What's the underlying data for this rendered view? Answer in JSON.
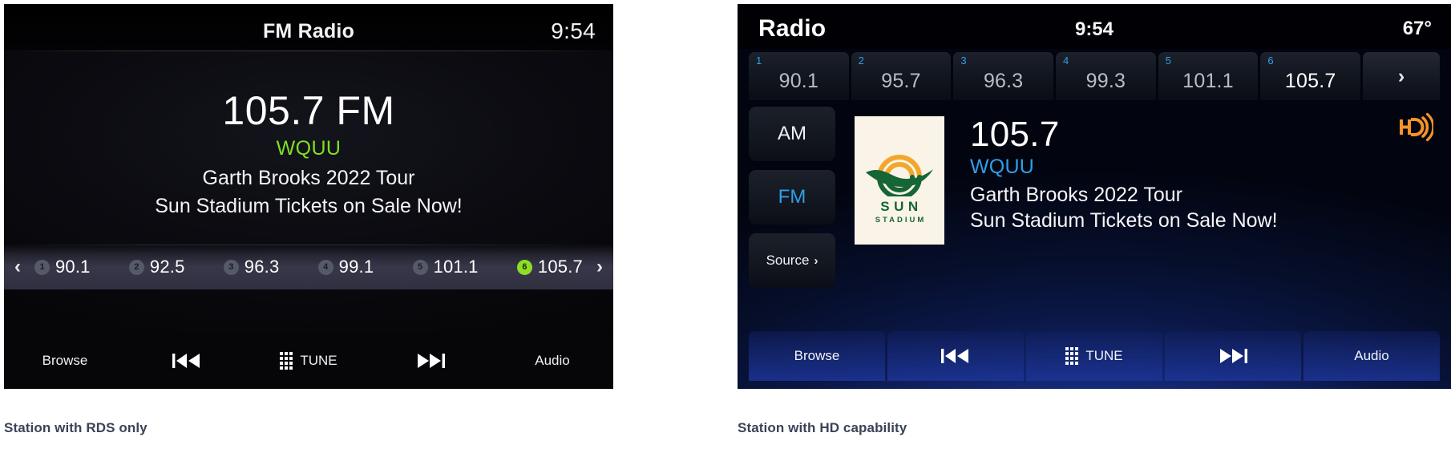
{
  "left_panel": {
    "header": {
      "title": "FM Radio",
      "clock": "9:54"
    },
    "now_playing": {
      "frequency": "105.7 FM",
      "call_sign": "WQUU",
      "info_line_1": "Garth Brooks 2022 Tour",
      "info_line_2": "Sun Stadium Tickets on Sale Now!"
    },
    "preset_bar": {
      "prev_arrow": "‹",
      "next_arrow": "›",
      "presets": [
        {
          "number": "1",
          "frequency": "90.1",
          "active": false
        },
        {
          "number": "2",
          "frequency": "92.5",
          "active": false
        },
        {
          "number": "3",
          "frequency": "96.3",
          "active": false
        },
        {
          "number": "4",
          "frequency": "99.1",
          "active": false
        },
        {
          "number": "5",
          "frequency": "101.1",
          "active": false
        },
        {
          "number": "6",
          "frequency": "105.7",
          "active": true
        }
      ]
    },
    "toolbar": {
      "browse": "Browse",
      "previous": "prev-track-icon",
      "tune": "TUNE",
      "next": "next-track-icon",
      "audio": "Audio"
    },
    "caption": "Station with RDS only"
  },
  "right_panel": {
    "header": {
      "title": "Radio",
      "clock": "9:54",
      "temperature": "67°"
    },
    "preset_row": {
      "presets": [
        {
          "number": "1",
          "frequency": "90.1",
          "active": false
        },
        {
          "number": "2",
          "frequency": "95.7",
          "active": false
        },
        {
          "number": "3",
          "frequency": "96.3",
          "active": false
        },
        {
          "number": "4",
          "frequency": "99.3",
          "active": false
        },
        {
          "number": "5",
          "frequency": "101.1",
          "active": false
        },
        {
          "number": "6",
          "frequency": "105.7",
          "active": true
        }
      ],
      "more_arrow": "›"
    },
    "side_buttons": {
      "am": "AM",
      "fm": "FM",
      "source": "Source",
      "source_chevron": "›"
    },
    "album_art": {
      "logo_primary": "SUN",
      "logo_secondary": "STADIUM"
    },
    "now_playing": {
      "frequency": "105.7",
      "call_sign": "WQUU",
      "info_line_1": "Garth Brooks 2022 Tour",
      "info_line_2": "Sun Stadium Tickets on Sale Now!"
    },
    "hd_badge": "hd-radio-icon",
    "toolbar": {
      "browse": "Browse",
      "previous": "prev-track-icon",
      "tune": "TUNE",
      "next": "next-track-icon",
      "audio": "Audio"
    },
    "caption": "Station with HD capability"
  },
  "colors": {
    "rds_call_sign_green": "#7ee01f",
    "rds_active_preset_badge": "#8ede26",
    "hd_accent_blue": "#2f9ee8",
    "hd_badge_orange": "#f59426",
    "logo_green": "#166534",
    "logo_orange": "#f2a72c",
    "caption_text": "#3c4257"
  }
}
